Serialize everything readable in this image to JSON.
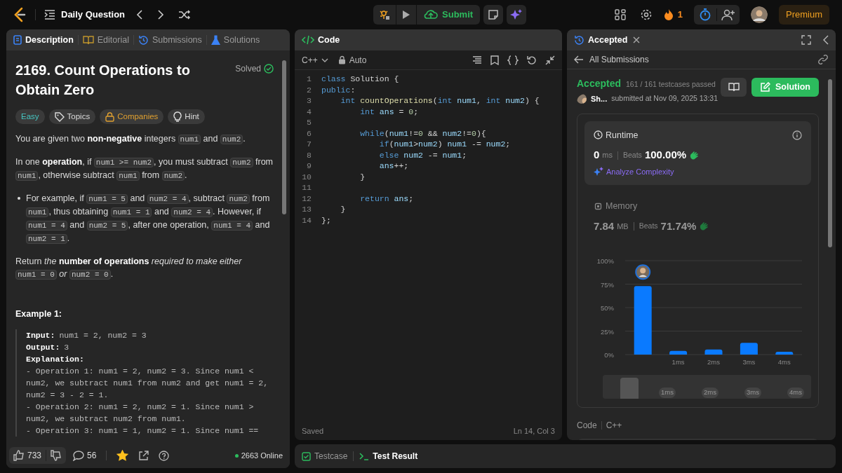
{
  "topbar": {
    "title": "Daily Question",
    "submit": "Submit",
    "streak": "1",
    "premium": "Premium"
  },
  "left_panel": {
    "tabs": [
      {
        "label": "Description",
        "selected": true,
        "kind": "description"
      },
      {
        "label": "Editorial",
        "selected": false,
        "kind": "editorial"
      },
      {
        "label": "Submissions",
        "selected": false,
        "kind": "submissions"
      },
      {
        "label": "Solutions",
        "selected": false,
        "kind": "solutions"
      }
    ],
    "title": "2169. Count Operations to Obtain Zero",
    "status": "Solved",
    "tags": [
      {
        "label": "Easy",
        "kind": "difficulty"
      },
      {
        "label": "Topics",
        "kind": "topics"
      },
      {
        "label": "Companies",
        "kind": "companies"
      },
      {
        "label": "Hint",
        "kind": "hint"
      }
    ],
    "paragraphs": [
      {
        "kind": "p",
        "segs": [
          {
            "t": "You are given two **non-negative** integers "
          },
          {
            "c": "num1"
          },
          {
            "t": " and "
          },
          {
            "c": "num2"
          },
          {
            "t": "."
          }
        ]
      },
      {
        "kind": "p",
        "segs": [
          {
            "t": "In one **operation**, if "
          },
          {
            "c": "num1 >= num2"
          },
          {
            "t": ", you must subtract "
          },
          {
            "c": "num2"
          },
          {
            "t": " from "
          },
          {
            "c": "num1"
          },
          {
            "t": ", otherwise subtract "
          },
          {
            "c": "num1"
          },
          {
            "t": " from "
          },
          {
            "c": "num2"
          },
          {
            "t": "."
          }
        ]
      },
      {
        "kind": "bullet",
        "segs": [
          {
            "t": "For example, if "
          },
          {
            "c": "num1 = 5"
          },
          {
            "t": " and "
          },
          {
            "c": "num2 = 4"
          },
          {
            "t": ", subtract "
          },
          {
            "c": "num2"
          },
          {
            "t": " from "
          },
          {
            "c": "num1"
          },
          {
            "t": ", thus obtaining "
          },
          {
            "c": "num1 = 1"
          },
          {
            "t": " and "
          },
          {
            "c": "num2 = 4"
          },
          {
            "t": ". However, if "
          },
          {
            "c": "num1 = 4"
          },
          {
            "t": " and "
          },
          {
            "c": "num2 = 5"
          },
          {
            "t": ", after one operation, "
          },
          {
            "c": "num1 = 4"
          },
          {
            "t": " and "
          },
          {
            "c": "num2 = 1"
          },
          {
            "t": "."
          }
        ]
      },
      {
        "kind": "p",
        "segs": [
          {
            "t": "Return *the* **number of operations** *required to make either* "
          },
          {
            "c": "num1 = 0"
          },
          {
            "t": " *or* "
          },
          {
            "c": "num2 = 0"
          },
          {
            "t": "."
          }
        ]
      }
    ],
    "example": {
      "heading": "Example 1:",
      "rows": [
        {
          "label": "Input:",
          "text": "num1 = 2, num2 = 3"
        },
        {
          "label": "Output:",
          "text": "3"
        },
        {
          "label": "Explanation:"
        }
      ],
      "lines": [
        "- Operation 1: num1 = 2, num2 = 3. Since num1 < num2, we subtract num1 from num2 and get num1 = 2, num2 = 3 - 2 = 1.",
        "- Operation 2: num1 = 2, num2 = 1. Since num1 > num2, we subtract num2 from num1.",
        "- Operation 3: num1 = 1, num2 = 1. Since num1 =="
      ]
    },
    "footer": {
      "likes": "733",
      "comments": "56",
      "starred": true,
      "online": "2663 Online"
    }
  },
  "code_panel": {
    "title": "Code",
    "language": "C++",
    "mode": "Auto",
    "status": "Saved",
    "cursor": "Ln 14, Col 3",
    "lines": [
      {
        "n": "1",
        "toks": [
          {
            "kind": "keyword",
            "t": "class "
          },
          {
            "kind": "plain",
            "t": "Solution {"
          }
        ]
      },
      {
        "n": "2",
        "toks": [
          {
            "kind": "keyword",
            "t": "public"
          },
          {
            "kind": "plain",
            "t": ":"
          }
        ]
      },
      {
        "n": "3",
        "toks": [
          {
            "kind": "keyword",
            "t": "    int "
          },
          {
            "kind": "function",
            "t": "countOperations"
          },
          {
            "kind": "plain",
            "t": "("
          },
          {
            "kind": "keyword",
            "t": "int "
          },
          {
            "kind": "variable",
            "t": "num1"
          },
          {
            "kind": "plain",
            "t": ", "
          },
          {
            "kind": "keyword",
            "t": "int "
          },
          {
            "kind": "variable",
            "t": "num2"
          },
          {
            "kind": "plain",
            "t": ") {"
          }
        ]
      },
      {
        "n": "4",
        "toks": [
          {
            "kind": "keyword",
            "t": "        int "
          },
          {
            "kind": "variable",
            "t": "ans"
          },
          {
            "kind": "plain",
            "t": " = "
          },
          {
            "kind": "number",
            "t": "0"
          },
          {
            "kind": "plain",
            "t": ";"
          }
        ]
      },
      {
        "n": "5"
      },
      {
        "n": "6",
        "toks": [
          {
            "kind": "keyword",
            "t": "        while"
          },
          {
            "kind": "plain",
            "t": "("
          },
          {
            "kind": "variable",
            "t": "num1"
          },
          {
            "kind": "plain",
            "t": "!="
          },
          {
            "kind": "number",
            "t": "0"
          },
          {
            "kind": "plain",
            "t": " && "
          },
          {
            "kind": "variable",
            "t": "num2"
          },
          {
            "kind": "plain",
            "t": "!="
          },
          {
            "kind": "number",
            "t": "0"
          },
          {
            "kind": "plain",
            "t": "){"
          }
        ]
      },
      {
        "n": "7",
        "toks": [
          {
            "kind": "keyword",
            "t": "            if"
          },
          {
            "kind": "plain",
            "t": "("
          },
          {
            "kind": "variable",
            "t": "num1"
          },
          {
            "kind": "plain",
            "t": ">"
          },
          {
            "kind": "variable",
            "t": "num2"
          },
          {
            "kind": "plain",
            "t": ") "
          },
          {
            "kind": "variable",
            "t": "num1"
          },
          {
            "kind": "plain",
            "t": " -= "
          },
          {
            "kind": "variable",
            "t": "num2"
          },
          {
            "kind": "plain",
            "t": ";"
          }
        ]
      },
      {
        "n": "8",
        "toks": [
          {
            "kind": "keyword",
            "t": "            else "
          },
          {
            "kind": "variable",
            "t": "num2"
          },
          {
            "kind": "plain",
            "t": " -= "
          },
          {
            "kind": "variable",
            "t": "num1"
          },
          {
            "kind": "plain",
            "t": ";"
          }
        ]
      },
      {
        "n": "9",
        "toks": [
          {
            "kind": "variable",
            "t": "            ans"
          },
          {
            "kind": "plain",
            "t": "++;"
          }
        ]
      },
      {
        "n": "10",
        "toks": [
          {
            "kind": "plain",
            "t": "        }"
          }
        ]
      },
      {
        "n": "11"
      },
      {
        "n": "12",
        "toks": [
          {
            "kind": "keyword",
            "t": "        return "
          },
          {
            "kind": "variable",
            "t": "ans"
          },
          {
            "kind": "plain",
            "t": ";"
          }
        ]
      },
      {
        "n": "13",
        "toks": [
          {
            "kind": "plain",
            "t": "    }"
          }
        ]
      },
      {
        "n": "14",
        "toks": [
          {
            "kind": "plain",
            "t": "};"
          }
        ]
      }
    ]
  },
  "result_panel": {
    "tab": "Accepted",
    "back": "All Submissions",
    "status": "Accepted",
    "testcases": "161 / 161 testcases passed",
    "user": "Sh...",
    "submitted": "submitted at Nov 09, 2025 13:31",
    "solution_button": "Solution",
    "metrics": [
      {
        "kind": "runtime",
        "label": "Runtime",
        "value": "0",
        "unit": "ms",
        "beats_label": "Beats",
        "beats": "100.00%",
        "selected": true,
        "analyze": "Analyze Complexity"
      },
      {
        "kind": "memory",
        "label": "Memory",
        "value": "7.84",
        "unit": "MB",
        "beats_label": "Beats",
        "beats": "71.74%",
        "selected": false
      }
    ],
    "chart_data": {
      "type": "bar",
      "grid": true,
      "categories": [
        null,
        "1ms",
        "2ms",
        "3ms",
        "4ms"
      ],
      "values": [
        73,
        4,
        5.5,
        12.5,
        3
      ],
      "ylim": [
        0,
        100
      ],
      "yticks": [
        {
          "value": 0,
          "label": "0%"
        },
        {
          "value": 25,
          "label": "25%"
        },
        {
          "value": 50,
          "label": "50%"
        },
        {
          "value": 75,
          "label": "75%"
        },
        {
          "value": 100,
          "label": "100%"
        }
      ]
    },
    "overview_labels": [
      "1ms",
      "2ms",
      "3ms",
      "4ms"
    ],
    "code_label": "Code",
    "code_language": "C++"
  },
  "bottom_tabs": [
    {
      "label": "Testcase",
      "selected": false,
      "kind": "testcase"
    },
    {
      "label": "Test Result",
      "selected": true,
      "kind": "result"
    }
  ]
}
